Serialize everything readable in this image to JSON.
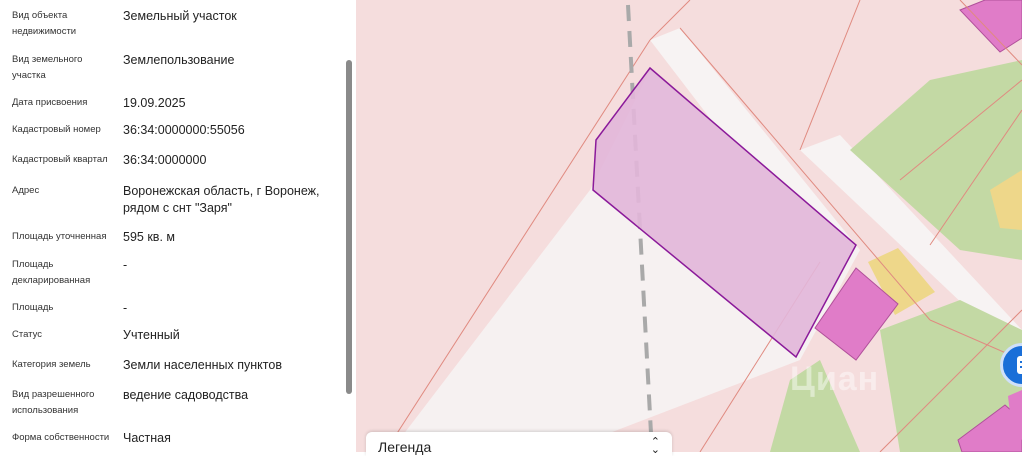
{
  "properties": [
    {
      "label": "Вид объекта недвижимости",
      "value": "Земельный участок"
    },
    {
      "label": "Вид земельного участка",
      "value": "Землепользование"
    },
    {
      "label": "Дата присвоения",
      "value": "19.09.2025"
    },
    {
      "label": "Кадастровый номер",
      "value": "36:34:0000000:55056"
    },
    {
      "label": "Кадастровый квартал",
      "value": "36:34:0000000"
    },
    {
      "label": "Адрес",
      "value": "Воронежская область, г Воронеж, рядом с снт \"Заря\""
    },
    {
      "label": "Площадь уточненная",
      "value": "595 кв. м"
    },
    {
      "label": "Площадь декларированная",
      "value": "-"
    },
    {
      "label": "Площадь",
      "value": "-"
    },
    {
      "label": "Статус",
      "value": "Учтенный"
    },
    {
      "label": "Категория земель",
      "value": "Земли населенных пунктов"
    },
    {
      "label": "Вид разрешенного использования",
      "value": "ведение садоводства"
    },
    {
      "label": "Форма собственности",
      "value": "Частная"
    }
  ],
  "map": {
    "legend_title": "Легенда",
    "watermark": "Циан",
    "colors": {
      "background": "#f5dddd",
      "road": "#f7f3f3",
      "parcel_fill": "#e2b6d9",
      "parcel_stroke": "#8b1a9a",
      "building": "#e07cc8",
      "green": "#c3d9a4",
      "yellow": "#eed78a",
      "cadastral_line": "#e08a80"
    },
    "icons": [
      "expand-chevron-icon",
      "chat-button-icon"
    ]
  }
}
